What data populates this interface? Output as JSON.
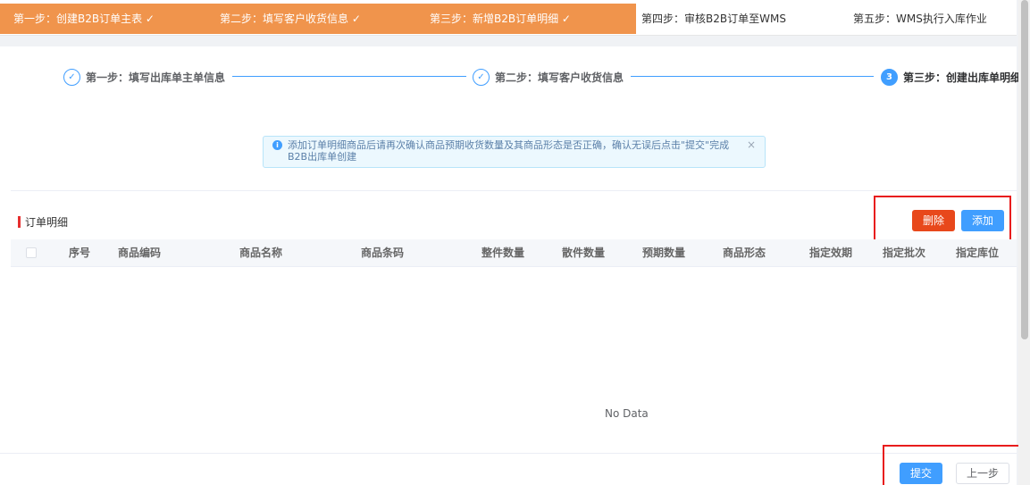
{
  "banner": {
    "steps": [
      {
        "label": "第一步：创建B2B订单主表 ✓"
      },
      {
        "label": "第二步：填写客户收货信息 ✓"
      },
      {
        "label": "第三步：新增B2B订单明细 ✓"
      },
      {
        "label": "第四步：审核B2B订单至WMS"
      },
      {
        "label": "第五步：WMS执行入库作业"
      }
    ]
  },
  "progress": {
    "steps": [
      {
        "icon": "✓",
        "label": "第一步：填写出库单主单信息"
      },
      {
        "icon": "✓",
        "label": "第二步：填写客户收货信息"
      },
      {
        "icon": "3",
        "label": "第三步：创建出库单明细信"
      }
    ]
  },
  "alert": {
    "icon": "i",
    "text": "添加订单明细商品后请再次确认商品预期收货数量及其商品形态是否正确，确认无误后点击\"提交\"完成B2B出库单创建",
    "close": "×"
  },
  "section": {
    "title": "订单明细"
  },
  "actions": {
    "delete_label": "删除",
    "add_label": "添加"
  },
  "table": {
    "columns": [
      "序号",
      "商品编码",
      "商品名称",
      "商品条码",
      "整件数量",
      "散件数量",
      "预期数量",
      "商品形态",
      "指定效期",
      "指定批次",
      "指定库位"
    ],
    "rows": [],
    "empty_text": "No Data"
  },
  "footer": {
    "submit_label": "提交",
    "prev_label": "上一步"
  },
  "colors": {
    "banner_done": "#f0944c",
    "primary": "#409eff",
    "danger": "#e8481b",
    "highlight": "#e81c1c"
  }
}
